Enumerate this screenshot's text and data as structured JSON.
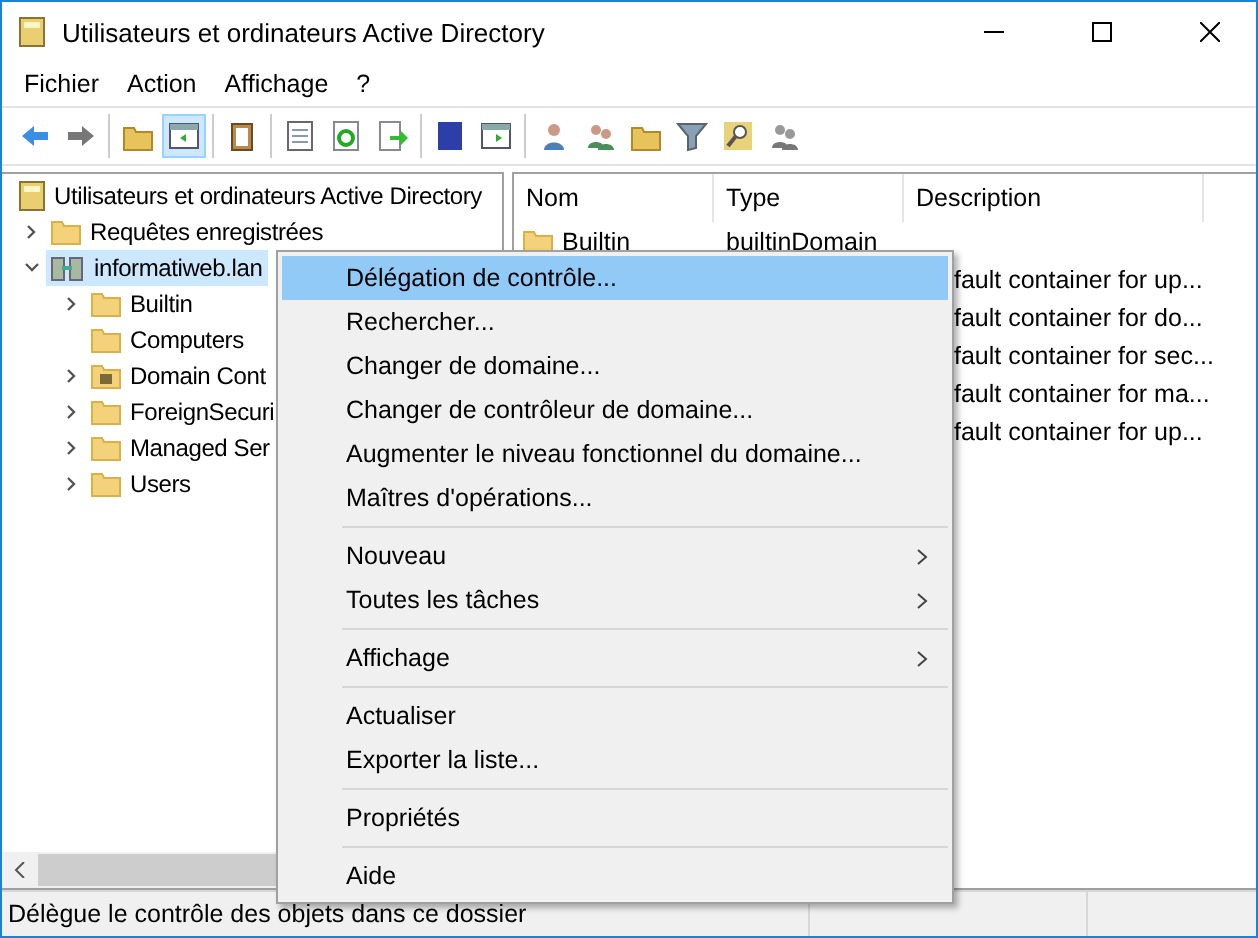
{
  "window": {
    "title": "Utilisateurs et ordinateurs Active Directory"
  },
  "menu_bar": [
    "Fichier",
    "Action",
    "Affichage",
    "?"
  ],
  "toolbar": [
    [
      {
        "pressed": false
      },
      {
        "pressed": false
      }
    ],
    [
      {
        "pressed": false
      },
      {
        "pressed": true
      }
    ],
    [
      {
        "pressed": false
      }
    ],
    [
      {
        "pressed": false
      },
      {
        "pressed": false
      },
      {
        "pressed": false
      }
    ],
    [
      {
        "pressed": false
      },
      {
        "pressed": false
      }
    ],
    [
      {
        "pressed": false
      },
      {
        "pressed": false
      },
      {
        "pressed": false
      },
      {
        "pressed": false
      },
      {
        "pressed": false
      },
      {
        "pressed": false
      }
    ]
  ],
  "tree": {
    "label": "Utilisateurs et ordinateurs Active Directory",
    "kind": "root",
    "selected": false,
    "children": [
      {
        "label": "Requêtes enregistrées",
        "kind": "folder",
        "expanded": false,
        "selected": false
      },
      {
        "label": "informatiweb.lan",
        "kind": "domain",
        "expanded": true,
        "selected": true,
        "children": [
          {
            "label": "Builtin",
            "kind": "folder",
            "expanded": false,
            "selected": false
          },
          {
            "label": "Computers",
            "kind": "folder",
            "selected": false
          },
          {
            "label": "Domain Cont",
            "kind": "ou",
            "expanded": false,
            "selected": false
          },
          {
            "label": "ForeignSecuri",
            "kind": "folder",
            "expanded": false,
            "selected": false
          },
          {
            "label": "Managed Ser",
            "kind": "folder",
            "expanded": false,
            "selected": false
          },
          {
            "label": "Users",
            "kind": "folder",
            "expanded": false,
            "selected": false
          }
        ]
      }
    ]
  },
  "table": {
    "columns": [
      "Nom",
      "Type",
      "Description"
    ],
    "rows": [
      {
        "name": "Builtin",
        "type": "builtinDomain"
      },
      {
        "description": "fault container for up..."
      },
      {
        "description": "fault container for do..."
      },
      {
        "description": "fault container for sec..."
      },
      {
        "description": "fault container for ma..."
      },
      {
        "description": "fault container for up..."
      }
    ]
  },
  "context_menu": [
    {
      "kind": "item",
      "label": "Délégation de contrôle...",
      "selected": true
    },
    {
      "kind": "item",
      "label": "Rechercher...",
      "selected": false
    },
    {
      "kind": "item",
      "label": "Changer de domaine...",
      "selected": false
    },
    {
      "kind": "item",
      "label": "Changer de contrôleur de domaine...",
      "selected": false
    },
    {
      "kind": "item",
      "label": "Augmenter le niveau fonctionnel du domaine...",
      "selected": false
    },
    {
      "kind": "item",
      "label": "Maîtres d'opérations...",
      "selected": false
    },
    {
      "kind": "separator"
    },
    {
      "kind": "submenu",
      "label": "Nouveau",
      "selected": false
    },
    {
      "kind": "submenu",
      "label": "Toutes les tâches",
      "selected": false
    },
    {
      "kind": "separator"
    },
    {
      "kind": "submenu",
      "label": "Affichage",
      "selected": false
    },
    {
      "kind": "separator"
    },
    {
      "kind": "item",
      "label": "Actualiser",
      "selected": false
    },
    {
      "kind": "item",
      "label": "Exporter la liste...",
      "selected": false
    },
    {
      "kind": "separator"
    },
    {
      "kind": "item",
      "label": "Propriétés",
      "selected": false
    },
    {
      "kind": "separator"
    },
    {
      "kind": "item",
      "label": "Aide",
      "selected": false
    }
  ],
  "status_bar": "Délègue le contrôle des objets dans ce dossier"
}
